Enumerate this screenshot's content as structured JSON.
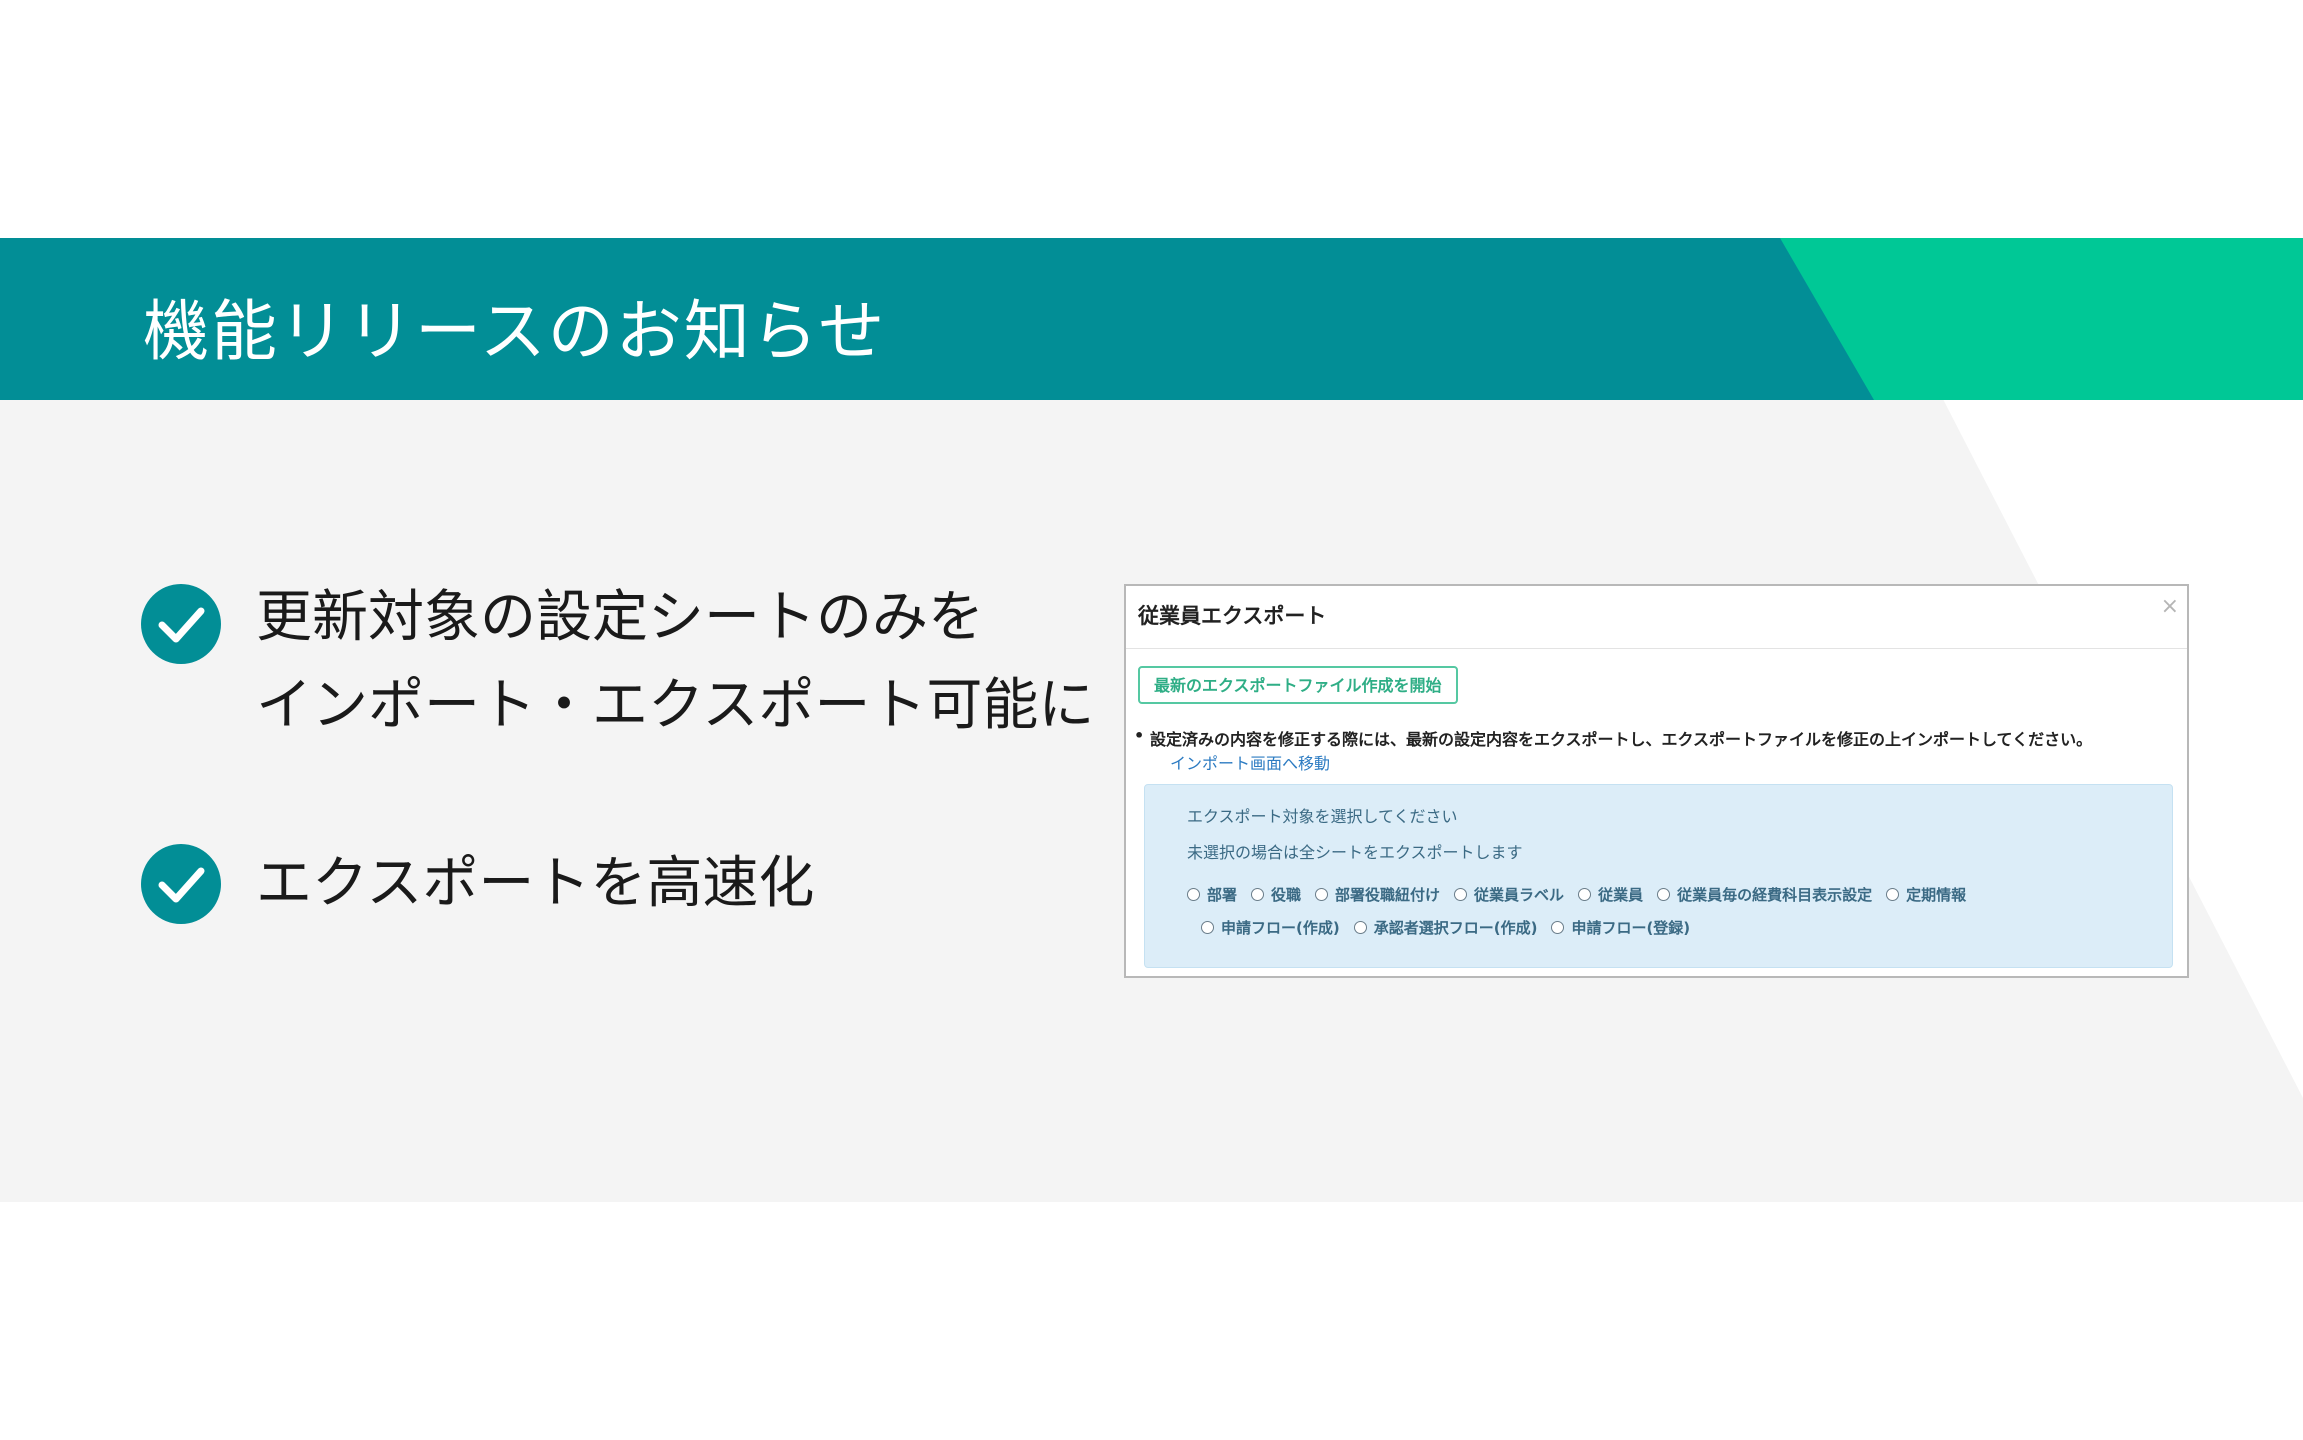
{
  "slide": {
    "title": "機能リリースのお知らせ",
    "colors": {
      "header_teal": "#028e96",
      "header_green": "#00c896",
      "background": "#f4f4f4",
      "check": "#028e96"
    },
    "bullets": [
      {
        "icon": "check-circle-icon",
        "lines": [
          "更新対象の設定シートのみを",
          "インポート・エクスポート可能に"
        ]
      },
      {
        "icon": "check-circle-icon",
        "lines": [
          "エクスポートを高速化"
        ]
      }
    ]
  },
  "dialog": {
    "title": "従業員エクスポート",
    "close_icon": "×",
    "start_button": "最新のエクスポートファイル作成を開始",
    "note": "設定済みの内容を修正する際には、最新の設定内容をエクスポートし、エクスポートファイルを修正の上インポートしてください。",
    "import_link": "インポート画面へ移動",
    "panel": {
      "instruction": "エクスポート対象を選択してください",
      "default_note": "未選択の場合は全シートをエクスポートします",
      "options_row1": [
        "部署",
        "役職",
        "部署役職紐付け",
        "従業員ラベル",
        "従業員",
        "従業員毎の経費科目表示設定",
        "定期情報"
      ],
      "options_row2": [
        "申請フロー(作成)",
        "承認者選択フロー(作成)",
        "申請フロー(登録)"
      ]
    }
  }
}
